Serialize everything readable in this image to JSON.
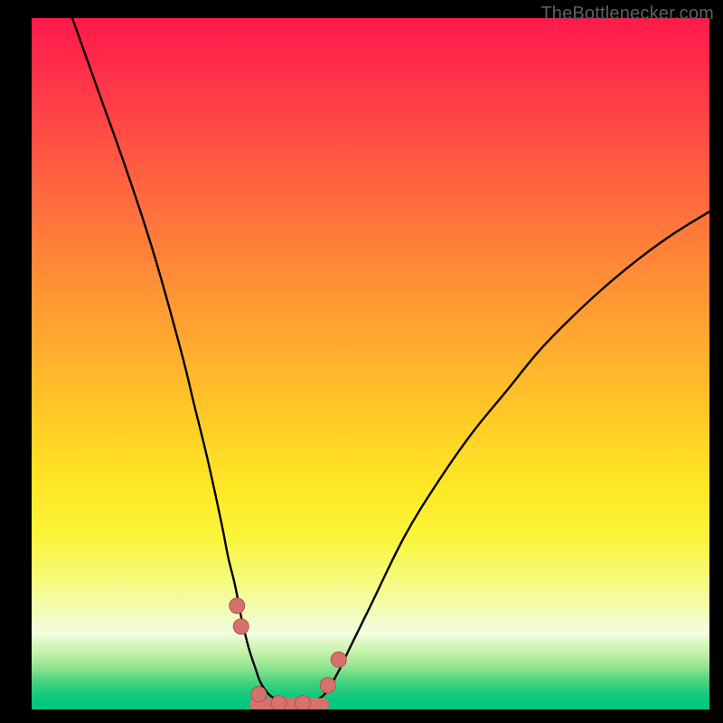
{
  "watermark": "TheBottlenecker.com",
  "colors": {
    "curve": "#000000",
    "marker_fill": "#d6726e",
    "marker_stroke": "#b94f4b",
    "bottom_line": "#d6726e"
  },
  "chart_data": {
    "type": "line",
    "title": "",
    "xlabel": "",
    "ylabel": "",
    "xlim": [
      0,
      100
    ],
    "ylim": [
      0,
      100
    ],
    "series": [
      {
        "name": "left-branch",
        "x": [
          6,
          10,
          14,
          18,
          22,
          24,
          26,
          28,
          29,
          30,
          31,
          32,
          33,
          34,
          36,
          40
        ],
        "y": [
          100,
          89,
          78,
          66,
          52,
          44,
          36,
          27,
          22,
          18,
          13,
          9,
          6,
          3.5,
          1.5,
          0.5
        ]
      },
      {
        "name": "right-branch",
        "x": [
          40,
          43,
          45,
          47,
          50,
          55,
          60,
          65,
          70,
          75,
          80,
          85,
          90,
          95,
          100
        ],
        "y": [
          0.5,
          2,
          5,
          9,
          15,
          25,
          33,
          40,
          46,
          52,
          57,
          61.5,
          65.5,
          69,
          72
        ]
      }
    ],
    "bottom_segment": {
      "x1": 33,
      "x2": 43,
      "y": 0.8
    },
    "markers": [
      {
        "x": 30.3,
        "y": 15
      },
      {
        "x": 30.9,
        "y": 12
      },
      {
        "x": 33.5,
        "y": 2.2
      },
      {
        "x": 36.5,
        "y": 0.9
      },
      {
        "x": 40.0,
        "y": 0.9
      },
      {
        "x": 43.7,
        "y": 3.5
      },
      {
        "x": 45.3,
        "y": 7.2
      }
    ]
  }
}
